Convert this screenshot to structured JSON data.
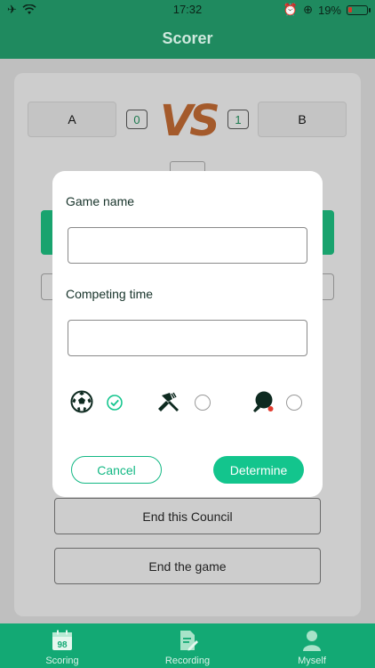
{
  "status_bar": {
    "time": "17:32",
    "battery": "19%"
  },
  "header": {
    "title": "Scorer"
  },
  "scoreboard": {
    "team_a": {
      "name": "A",
      "score": "0"
    },
    "team_b": {
      "name": "B",
      "score": "1"
    },
    "vs_label": "VS"
  },
  "actions": {
    "end_council": "End this Council",
    "end_game": "End the game"
  },
  "tabbar": {
    "tabs": [
      {
        "label": "Scoring",
        "icon": "calendar-98-icon"
      },
      {
        "label": "Recording",
        "icon": "edit-document-icon"
      },
      {
        "label": "Myself",
        "icon": "user-icon"
      }
    ],
    "calendar_number": "98"
  },
  "dialog": {
    "game_name_label": "Game name",
    "game_name_value": "",
    "competing_time_label": "Competing time",
    "competing_time_value": "",
    "sports": [
      {
        "icon": "soccer-ball-icon",
        "selected": true
      },
      {
        "icon": "badminton-shuttlecock-icon",
        "selected": false
      },
      {
        "icon": "ping-pong-paddle-icon",
        "selected": false
      }
    ],
    "cancel_label": "Cancel",
    "determine_label": "Determine"
  },
  "colors": {
    "primary": "#13c58d",
    "header": "#1f8a5f",
    "tabbar": "#13a974"
  }
}
